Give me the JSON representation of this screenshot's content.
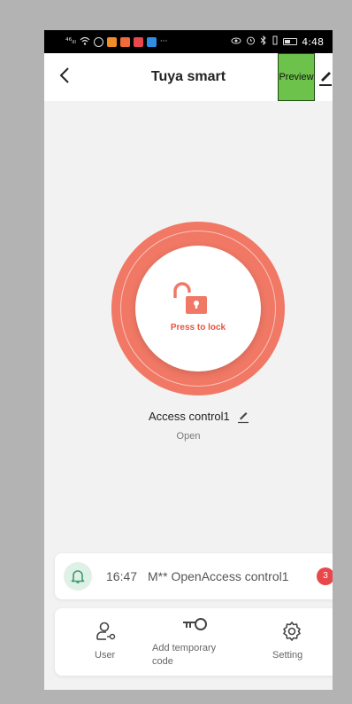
{
  "statusbar": {
    "signal": "⁴⁶ᵢₗₗ",
    "time": "4:48",
    "overflow": "···"
  },
  "navbar": {
    "title": "Tuya smart",
    "preview_label": "Preview"
  },
  "lock": {
    "action_label": "Press to lock",
    "device_name": "Access control1",
    "status": "Open"
  },
  "log": {
    "time": "16:47",
    "message": "M** OpenAccess control1",
    "badge_count": "3"
  },
  "toolbar": {
    "user_label": "User",
    "temp_code_label": "Add temporary code",
    "setting_label": "Setting"
  },
  "colors": {
    "accent": "#f07865",
    "accent_text": "#e5553f",
    "preview_highlight": "#6cc24a",
    "badge": "#e8484b",
    "bell_bg": "#dff0e6",
    "bell_icon": "#3a9b6a"
  }
}
